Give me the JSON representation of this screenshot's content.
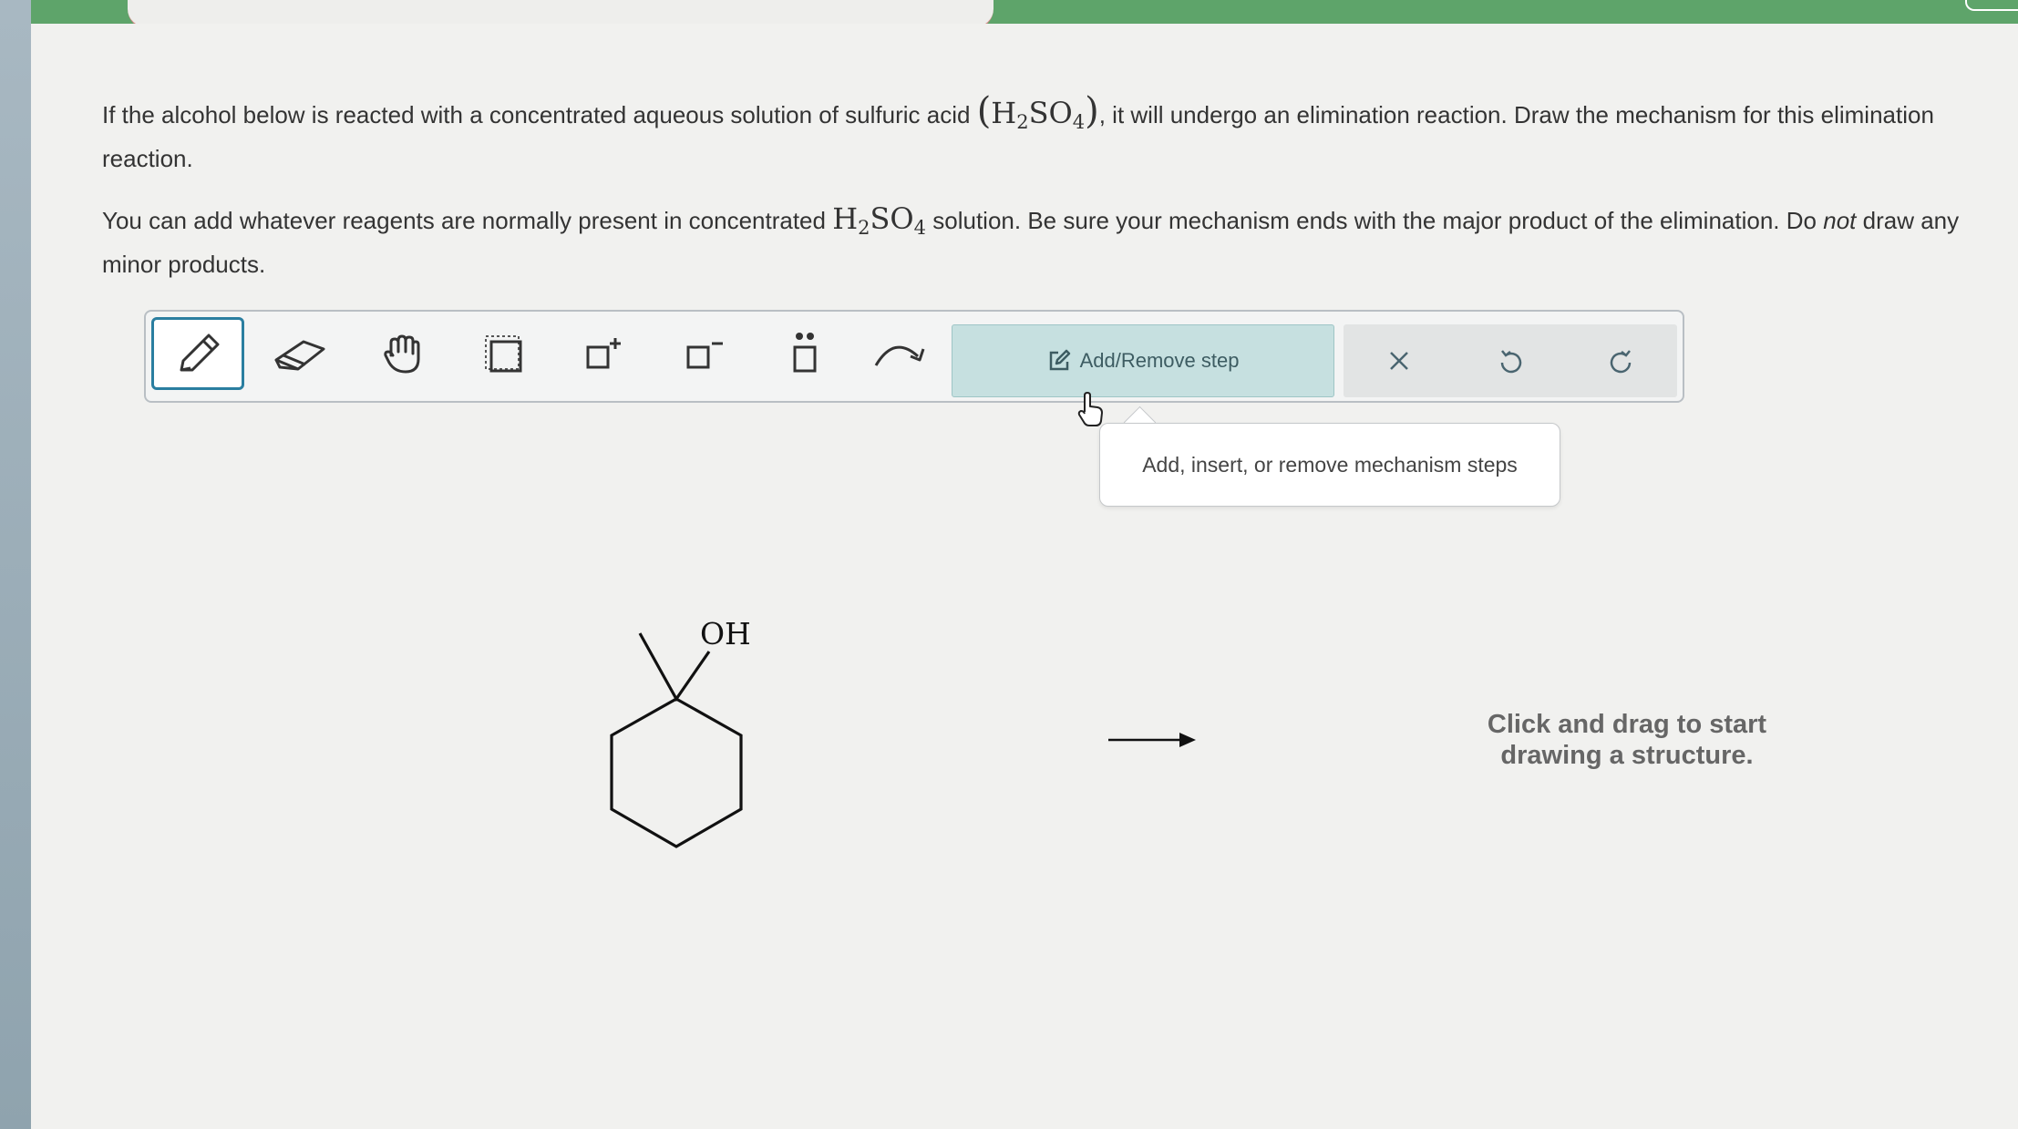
{
  "question": {
    "p1_before": "If the alcohol below is reacted with a concentrated aqueous solution of sulfuric acid",
    "p1_after": ", it will undergo an elimination reaction. Draw the mechanism for this elimination reaction.",
    "p2_before": "You can add whatever reagents are normally present in concentrated",
    "p2_after": "solution. Be sure your mechanism ends with the major product of the elimination.",
    "p2_do": "Do",
    "p2_not": "not",
    "p2_end": "draw any minor products.",
    "formula_H": "H",
    "formula_2": "2",
    "formula_SO": "SO",
    "formula_4": "4"
  },
  "toolbar": {
    "tools": [
      "pencil-icon",
      "eraser-icon",
      "hand-icon",
      "select-box-icon",
      "positive-charge-icon",
      "negative-charge-icon",
      "lone-pair-icon",
      "curved-arrow-icon"
    ],
    "add_remove_label": "Add/Remove step",
    "actions": [
      "clear-icon",
      "undo-icon",
      "redo-icon"
    ]
  },
  "tooltip": {
    "text": "Add, insert, or remove mechanism steps"
  },
  "molecule": {
    "label": "OH"
  },
  "canvas": {
    "hint_line1": "Click and drag to start",
    "hint_line2": "drawing a structure."
  },
  "colors": {
    "top_bar": "#5ea46a",
    "active_tool_border": "#2a7ea0",
    "add_step_bg": "#c6e0e0"
  }
}
